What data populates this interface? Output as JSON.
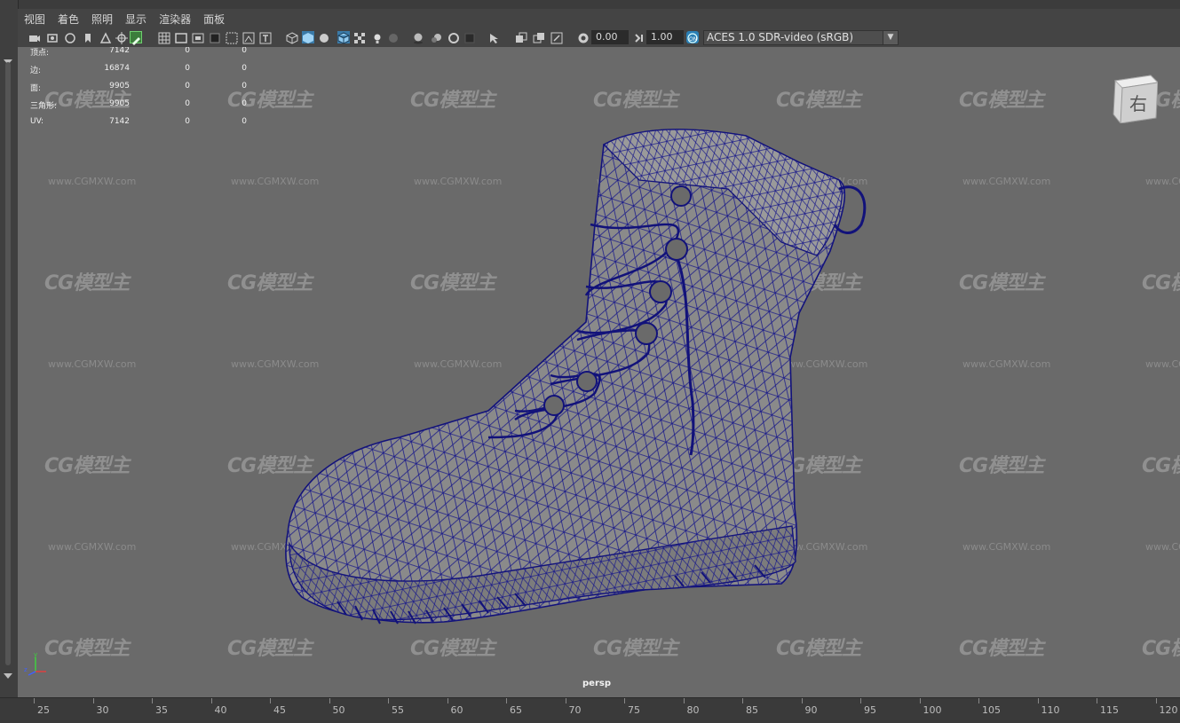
{
  "menu": [
    "视图",
    "着色",
    "照明",
    "显示",
    "渲染器",
    "面板"
  ],
  "toolbar": {
    "exposure": "0.00",
    "gamma": "1.00",
    "color_space": "ACES 1.0 SDR-video (sRGB)",
    "icons": [
      "camera-icon",
      "camera-attributes-icon",
      "bookmark-icon",
      "image-plane-icon",
      "grid-icon",
      "film-gate-icon",
      "resolution-gate-icon",
      "safe-action-icon",
      "safe-title-icon",
      "wireframe-icon",
      "smooth-shade-icon",
      "textured-icon",
      "lights-icon",
      "shadows-icon",
      "ambient-occlusion-icon",
      "motion-blur-icon",
      "isolate-select-icon",
      "xray-icon",
      "exposure-icon",
      "gamma-icon",
      "color-management-icon"
    ]
  },
  "hud": {
    "rows": [
      {
        "label": "顶点:",
        "v1": "7142",
        "v2": "0",
        "v3": "0"
      },
      {
        "label": "边:",
        "v1": "16874",
        "v2": "0",
        "v3": "0"
      },
      {
        "label": "面:",
        "v1": "9905",
        "v2": "0",
        "v3": "0"
      },
      {
        "label": "三角形:",
        "v1": "9905",
        "v2": "0",
        "v3": "0"
      },
      {
        "label": "UV:",
        "v1": "7142",
        "v2": "0",
        "v3": "0"
      }
    ]
  },
  "viewcube": {
    "face_label": "右"
  },
  "camera_label": "persp",
  "watermark": {
    "logo": "CG模型主",
    "url": "www.CGMXW.com"
  },
  "ruler": {
    "labels": [
      "25",
      "30",
      "35",
      "40",
      "45",
      "50",
      "55",
      "60",
      "65",
      "70",
      "75",
      "80",
      "85",
      "90",
      "95",
      "100",
      "105",
      "110",
      "115",
      "120"
    ]
  },
  "colors": {
    "wireframe": "#1a1a8c",
    "mesh_fill": "#8a8a8a",
    "viewport_bg": "#6a6a6a",
    "accent": "#3ca0d8"
  }
}
